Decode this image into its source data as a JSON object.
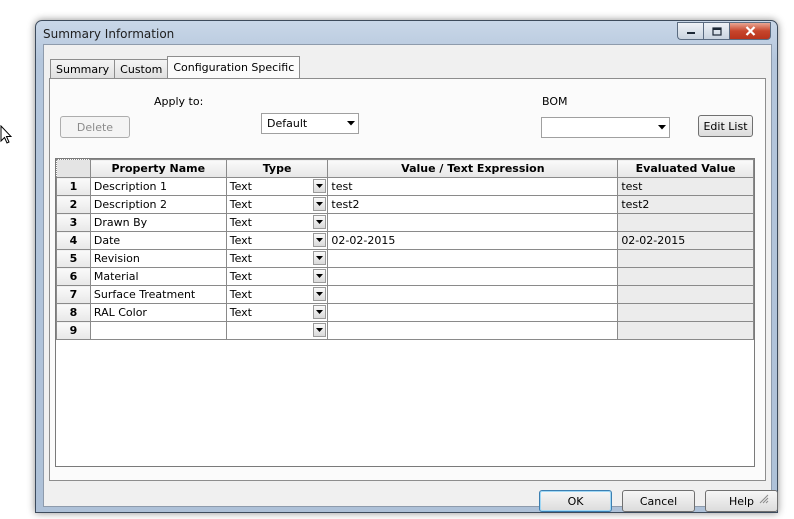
{
  "window": {
    "title": "Summary Information"
  },
  "tabs": [
    {
      "label": "Summary",
      "active": false
    },
    {
      "label": "Custom",
      "active": false
    },
    {
      "label": "Configuration Specific",
      "active": true
    }
  ],
  "config": {
    "apply_to_label": "Apply to:",
    "apply_to_value": "Default",
    "delete_label": "Delete",
    "bom_label": "BOM",
    "bom_value": "",
    "edit_list_label": "Edit List"
  },
  "table": {
    "columns": [
      "Property Name",
      "Type",
      "Value / Text Expression",
      "Evaluated Value"
    ],
    "rows": [
      {
        "num": "1",
        "name": "Description 1",
        "type": "Text",
        "value": "test",
        "evaluated": "test"
      },
      {
        "num": "2",
        "name": "Description 2",
        "type": "Text",
        "value": "test2",
        "evaluated": "test2"
      },
      {
        "num": "3",
        "name": "Drawn By",
        "type": "Text",
        "value": "",
        "evaluated": ""
      },
      {
        "num": "4",
        "name": "Date",
        "type": "Text",
        "value": "02-02-2015",
        "evaluated": "02-02-2015"
      },
      {
        "num": "5",
        "name": "Revision",
        "type": "Text",
        "value": "",
        "evaluated": ""
      },
      {
        "num": "6",
        "name": "Material",
        "type": "Text",
        "value": "",
        "evaluated": ""
      },
      {
        "num": "7",
        "name": "Surface Treatment",
        "type": "Text",
        "value": "",
        "evaluated": ""
      },
      {
        "num": "8",
        "name": "RAL Color",
        "type": "Text",
        "value": "",
        "evaluated": ""
      },
      {
        "num": "9",
        "name": "",
        "type": "",
        "value": "",
        "evaluated": ""
      }
    ]
  },
  "footer": {
    "ok_label": "OK",
    "cancel_label": "Cancel",
    "help_label": "Help"
  },
  "icons": {
    "cursor": "mouse-pointer-icon",
    "minimize": "minimize-icon",
    "maximize": "maximize-icon",
    "close": "close-icon",
    "dropdown": "dropdown-arrow-icon",
    "grip": "resize-grip-icon"
  }
}
